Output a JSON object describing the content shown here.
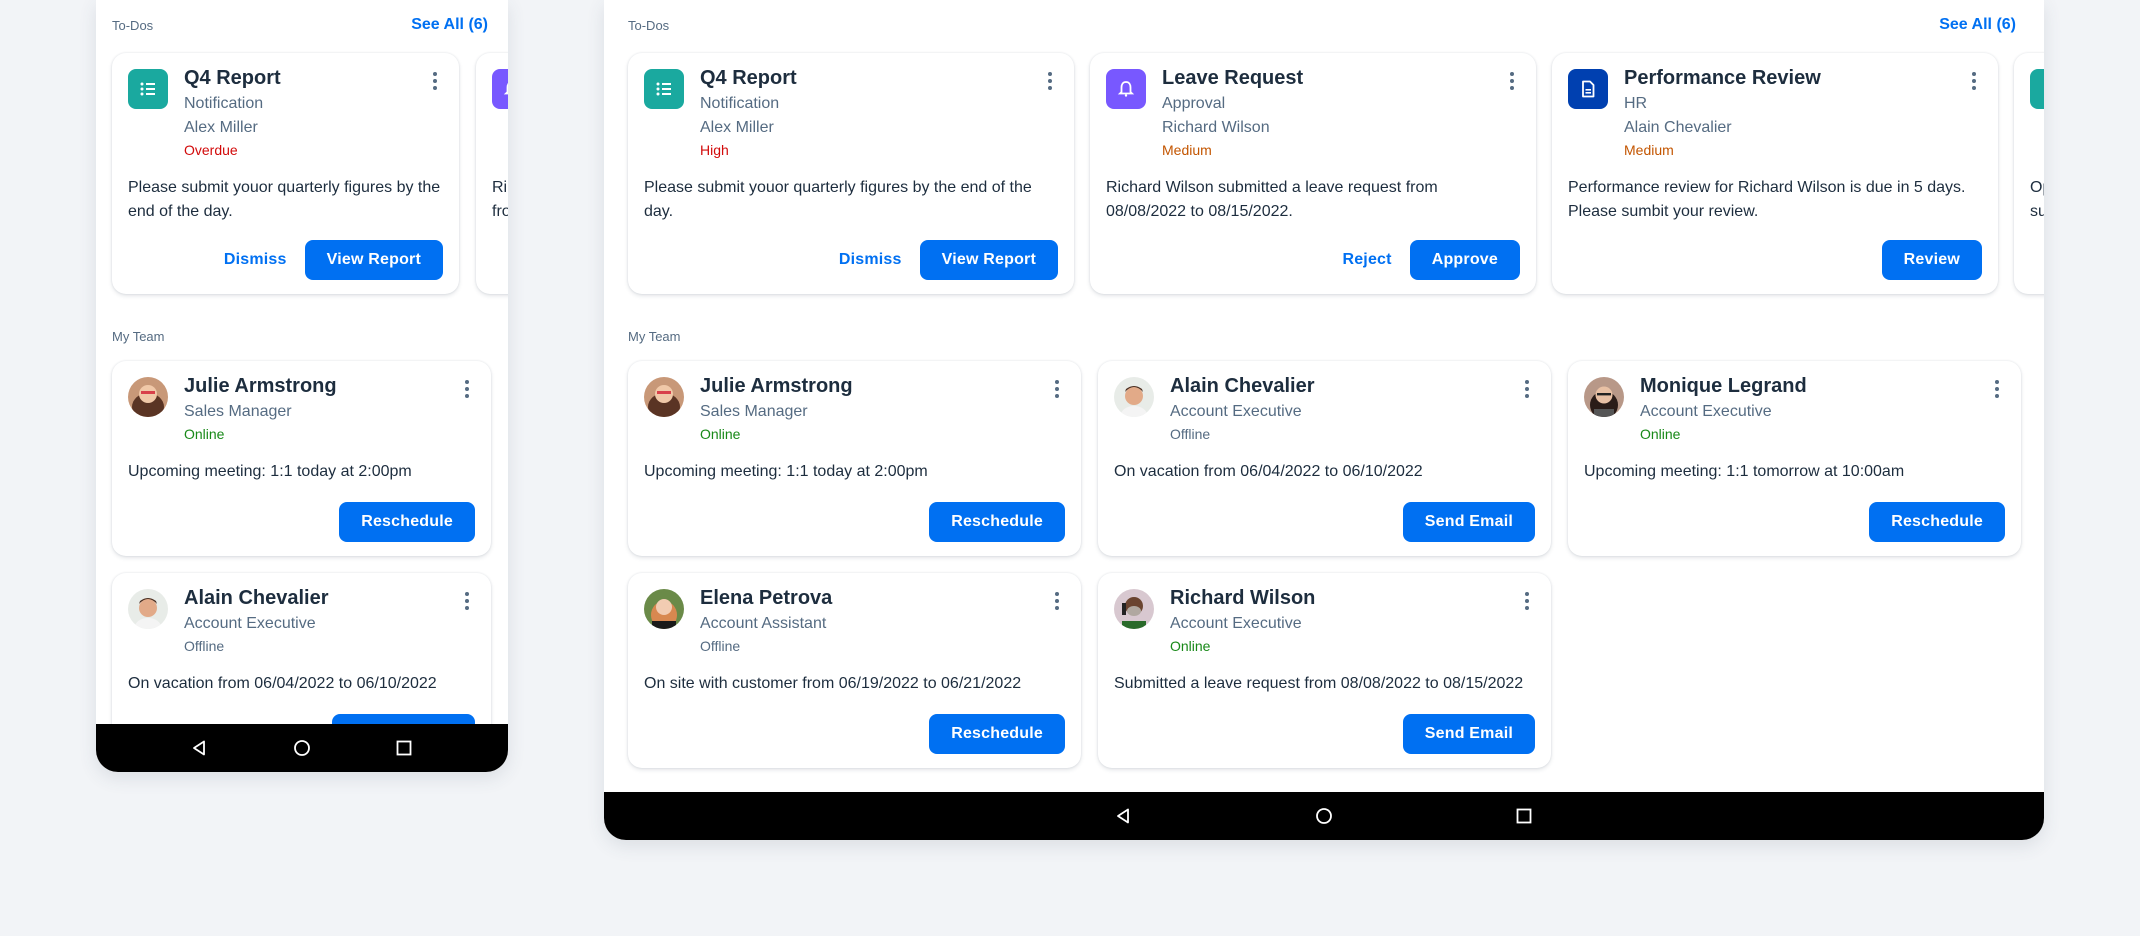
{
  "colors": {
    "accent": "#0070f2",
    "icon_teal": "#1aa99f",
    "icon_purple": "#7858ff",
    "icon_navy": "#0040b0",
    "status_negative": "#d20a0a",
    "status_critical": "#c35500",
    "status_positive": "#188918",
    "status_neutral": "#556b82",
    "background": "#f2f4f7"
  },
  "phone": {
    "todos": {
      "label": "To-Dos",
      "see_all": "See All (6)",
      "cards": [
        {
          "icon": "list-icon",
          "title": "Q4 Report",
          "type": "Notification",
          "person": "Alex Miller",
          "status": "Overdue",
          "body": "Please submit youor quarterly figures by the end of the day.",
          "secondary_action": "Dismiss",
          "primary_action": "View Report"
        },
        {
          "icon": "bell-icon",
          "body_partial": "Ri fro"
        }
      ]
    },
    "team": {
      "label": "My Team",
      "members": [
        {
          "name": "Julie Armstrong",
          "role": "Sales Manager",
          "presence": "Online",
          "note": "Upcoming meeting: 1:1 today at 2:00pm",
          "action": "Reschedule"
        },
        {
          "name": "Alain Chevalier",
          "role": "Account Executive",
          "presence": "Offline",
          "note": "On vacation from 06/04/2022 to 06/10/2022",
          "action": ""
        }
      ]
    },
    "navbar": [
      "back-icon",
      "home-icon",
      "recents-icon"
    ]
  },
  "tablet": {
    "todos": {
      "label": "To-Dos",
      "see_all": "See All (6)",
      "cards": [
        {
          "icon": "list-icon",
          "title": "Q4 Report",
          "type": "Notification",
          "person": "Alex Miller",
          "status": "High",
          "body": "Please submit youor quarterly figures by the end of the day.",
          "secondary_action": "Dismiss",
          "primary_action": "View Report"
        },
        {
          "icon": "bell-icon",
          "title": "Leave Request",
          "type": "Approval",
          "person": "Richard Wilson",
          "status": "Medium",
          "body": "Richard Wilson submitted a leave request from 08/08/2022 to 08/15/2022.",
          "secondary_action": "Reject",
          "primary_action": "Approve"
        },
        {
          "icon": "document-icon",
          "title": "Performance Review",
          "type": "HR",
          "person": "Alain Chevalier",
          "status": "Medium",
          "body": "Performance review for Richard Wilson is due in 5 days. Please sumbit your review.",
          "secondary_action": "",
          "primary_action": "Review"
        },
        {
          "icon": "trophy-icon",
          "body_partial": "Op su"
        }
      ]
    },
    "team": {
      "label": "My Team",
      "members": [
        {
          "name": "Julie Armstrong",
          "role": "Sales Manager",
          "presence": "Online",
          "note": "Upcoming meeting: 1:1 today at 2:00pm",
          "action": "Reschedule"
        },
        {
          "name": "Alain Chevalier",
          "role": "Account Executive",
          "presence": "Offline",
          "note": "On vacation from 06/04/2022 to 06/10/2022",
          "action": "Send Email"
        },
        {
          "name": "Monique Legrand",
          "role": "Account Executive",
          "presence": "Online",
          "note": "Upcoming meeting: 1:1 tomorrow at 10:00am",
          "action": "Reschedule"
        },
        {
          "name": "Elena Petrova",
          "role": "Account Assistant",
          "presence": "Offline",
          "note": "On site with customer from 06/19/2022 to 06/21/2022",
          "action": "Reschedule"
        },
        {
          "name": "Richard Wilson",
          "role": "Account Executive",
          "presence": "Online",
          "note": "Submitted a leave request from 08/08/2022 to 08/15/2022",
          "action": "Send Email"
        }
      ]
    },
    "navbar": [
      "back-icon",
      "home-icon",
      "recents-icon"
    ]
  }
}
